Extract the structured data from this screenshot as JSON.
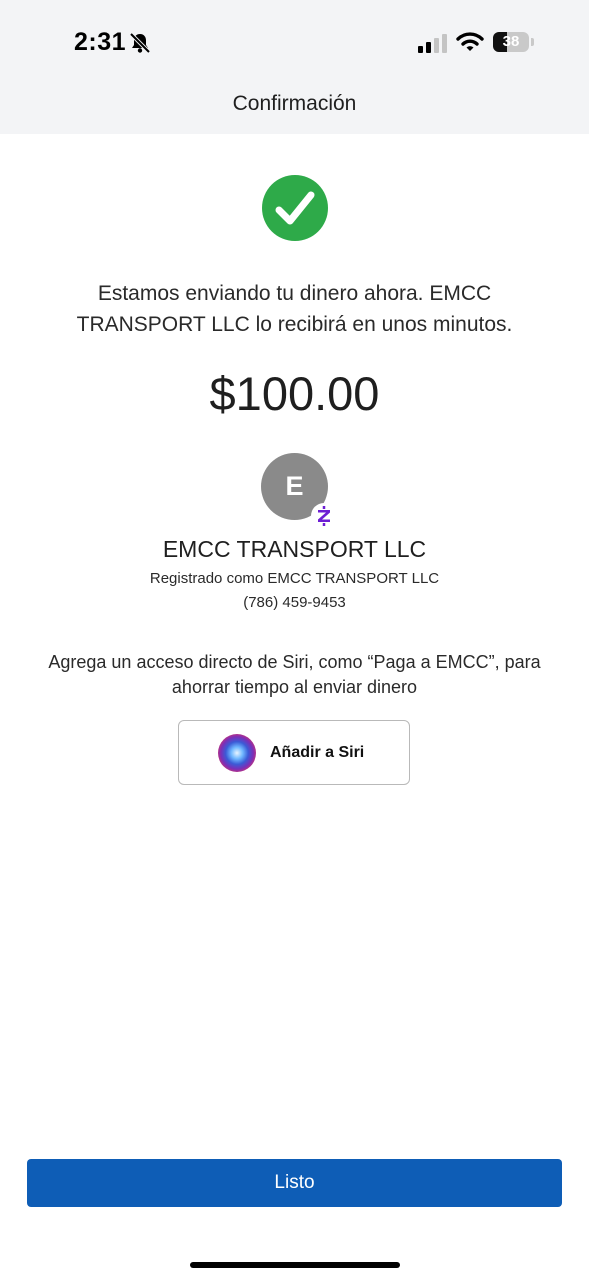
{
  "status_bar": {
    "time": "2:31",
    "battery_percent": "38",
    "battery_level": 0.38,
    "icons": [
      "bell-slash-icon",
      "cellular-signal-icon",
      "wifi-icon",
      "battery-icon"
    ]
  },
  "header": {
    "title": "Confirmación"
  },
  "confirmation": {
    "status_icon": "checkmark-icon",
    "accent_color": "#2eaa49",
    "message": "Estamos enviando tu dinero ahora. EMCC TRANSPORT LLC lo recibirá en unos minutos.",
    "amount": "$100.00"
  },
  "recipient": {
    "avatar_initial": "E",
    "badge_icon": "zelle-icon",
    "name": "EMCC TRANSPORT LLC",
    "registered_as": "Registrado como EMCC TRANSPORT LLC",
    "phone": "(786) 459-9453"
  },
  "siri": {
    "prompt": "Agrega un acceso directo de Siri, como “Paga a EMCC”, para ahorrar tiempo al enviar dinero",
    "button_label": "Añadir a Siri",
    "button_icon": "siri-icon"
  },
  "footer": {
    "done_label": "Listo",
    "done_color": "#0e5db6"
  }
}
